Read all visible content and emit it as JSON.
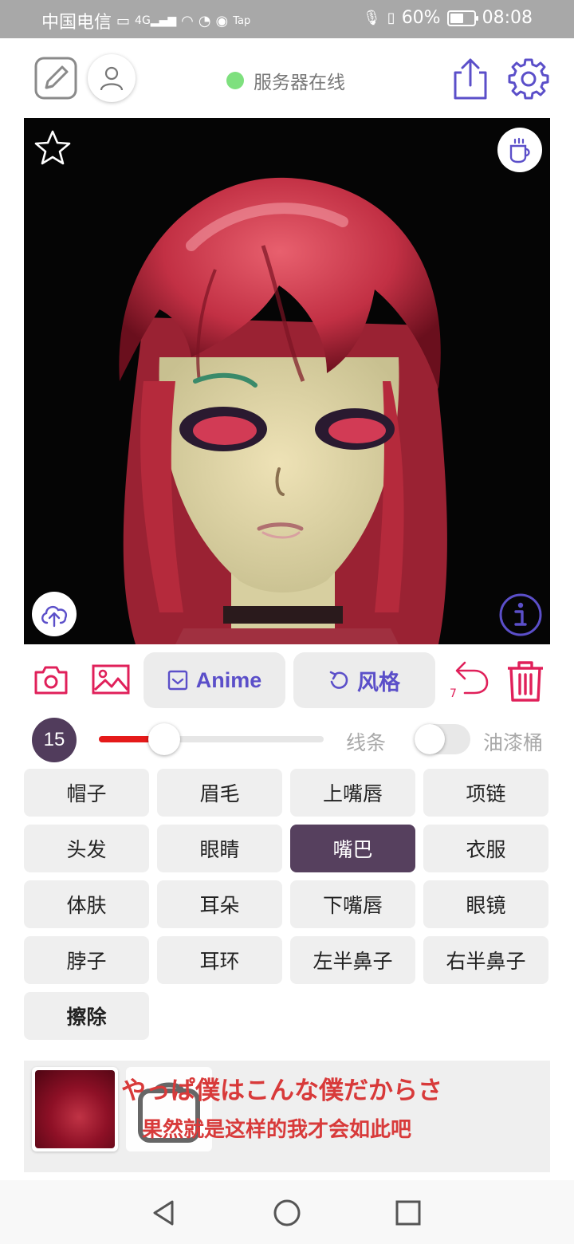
{
  "status_bar": {
    "carrier": "中国电信",
    "network": "4G",
    "battery": "60%",
    "battery_level": 0.6,
    "time": "08:08",
    "app_badge": "Tap"
  },
  "header": {
    "server_status": "服务器在线",
    "server_status_color": "#7ee07e"
  },
  "toolbar": {
    "style_label": "Anime",
    "restyle_label": "风格",
    "undo_count": "7",
    "accent_color": "#e0205a"
  },
  "brush": {
    "size": "15",
    "slider_fraction": 0.29,
    "line_label": "线条",
    "bucket_label": "油漆桶",
    "bucket_enabled": false
  },
  "parts": [
    {
      "label": "帽子",
      "selected": false
    },
    {
      "label": "眉毛",
      "selected": false
    },
    {
      "label": "上嘴唇",
      "selected": false
    },
    {
      "label": "项链",
      "selected": false
    },
    {
      "label": "头发",
      "selected": false
    },
    {
      "label": "眼睛",
      "selected": false
    },
    {
      "label": "嘴巴",
      "selected": true
    },
    {
      "label": "衣服",
      "selected": false
    },
    {
      "label": "体肤",
      "selected": false
    },
    {
      "label": "耳朵",
      "selected": false
    },
    {
      "label": "下嘴唇",
      "selected": false
    },
    {
      "label": "眼镜",
      "selected": false
    },
    {
      "label": "脖子",
      "selected": false
    },
    {
      "label": "耳环",
      "selected": false
    },
    {
      "label": "左半鼻子",
      "selected": false
    },
    {
      "label": "右半鼻子",
      "selected": false
    },
    {
      "label": "擦除",
      "selected": false
    }
  ],
  "lyrics": {
    "line1": "やっぱ僕はこんな僕だからさ",
    "line2": "果然就是这样的我才会如此吧"
  },
  "icons": {
    "edit": "edit-square-icon",
    "profile": "user-icon",
    "share": "share-icon",
    "settings": "gear-icon",
    "favorite": "star-icon",
    "coffee": "coffee-icon",
    "upload": "cloud-upload-icon",
    "info": "info-icon",
    "camera": "camera-icon",
    "gallery": "image-icon",
    "undo": "undo-icon",
    "delete": "trash-icon"
  }
}
